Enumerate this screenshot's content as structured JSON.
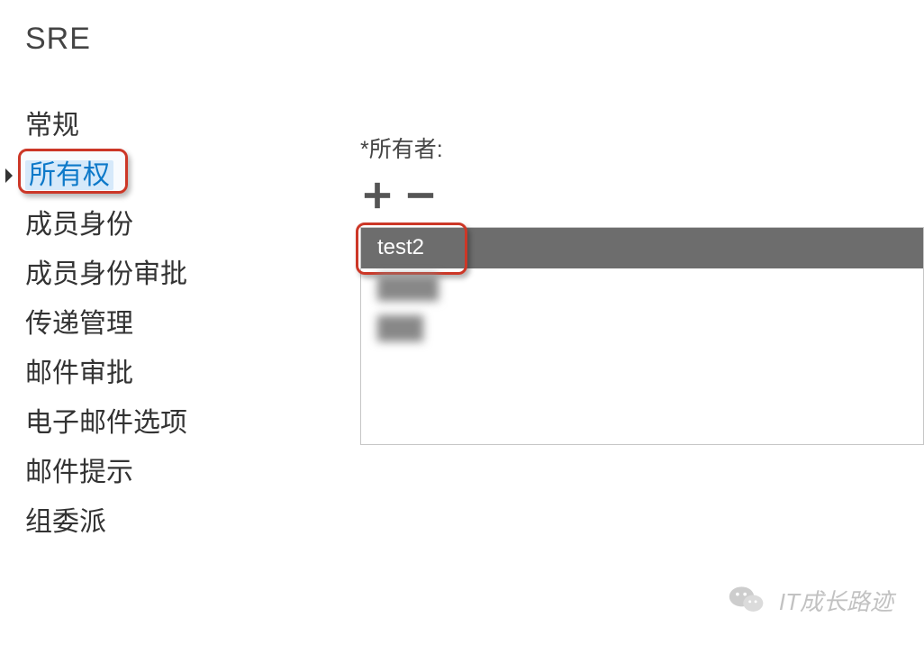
{
  "header": {
    "title": "SRE"
  },
  "sidebar": {
    "items": [
      {
        "label": "常规",
        "selected": false
      },
      {
        "label": "所有权",
        "selected": true,
        "highlighted": true
      },
      {
        "label": "成员身份",
        "selected": false
      },
      {
        "label": "成员身份审批",
        "selected": false
      },
      {
        "label": "传递管理",
        "selected": false
      },
      {
        "label": "邮件审批",
        "selected": false
      },
      {
        "label": "电子邮件选项",
        "selected": false
      },
      {
        "label": "邮件提示",
        "selected": false
      },
      {
        "label": "组委派",
        "selected": false
      }
    ]
  },
  "main": {
    "owners_label": "*所有者:",
    "add_icon": "plus-icon",
    "remove_icon": "minus-icon",
    "owners": [
      {
        "name": "test2",
        "selected": true,
        "highlighted": true,
        "obscured": false
      },
      {
        "name": "████",
        "selected": false,
        "obscured": true
      },
      {
        "name": "███",
        "selected": false,
        "obscured": true
      }
    ]
  },
  "watermark": {
    "text": "IT成长路迹"
  }
}
